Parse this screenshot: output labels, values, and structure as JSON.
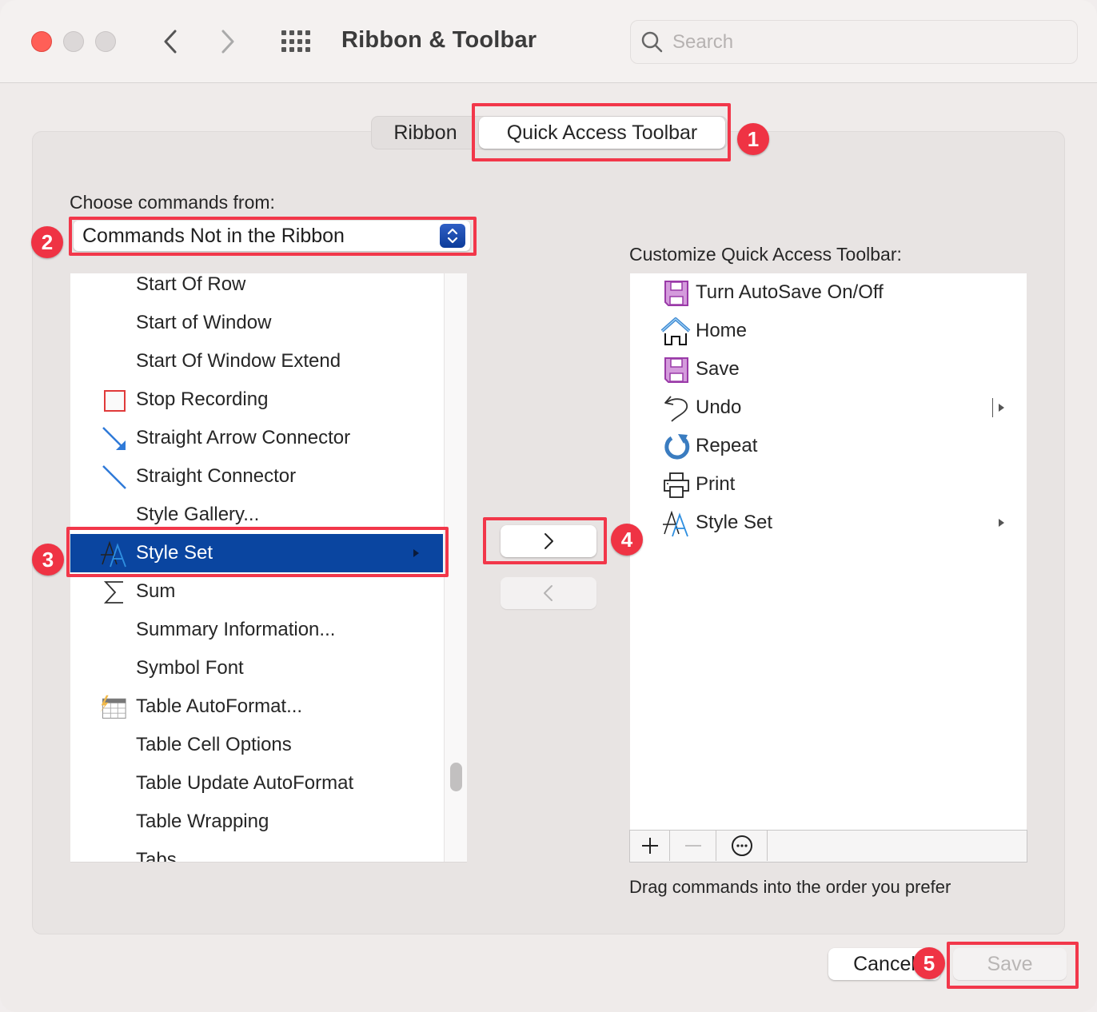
{
  "window": {
    "title": "Ribbon & Toolbar",
    "search_placeholder": "Search",
    "search_value": ""
  },
  "tabs": [
    {
      "label": "Ribbon",
      "selected": false
    },
    {
      "label": "Quick Access Toolbar",
      "selected": true
    }
  ],
  "left_pane": {
    "label": "Choose commands from:",
    "dropdown_value": "Commands Not in the Ribbon",
    "items": [
      {
        "label": "Start Of Row",
        "icon": "none"
      },
      {
        "label": "Start of Window",
        "icon": "none"
      },
      {
        "label": "Start Of Window Extend",
        "icon": "none"
      },
      {
        "label": "Stop Recording",
        "icon": "stop-square-icon"
      },
      {
        "label": "Straight Arrow Connector",
        "icon": "arrow-connector-icon"
      },
      {
        "label": "Straight Connector",
        "icon": "line-connector-icon"
      },
      {
        "label": "Style Gallery...",
        "icon": "none"
      },
      {
        "label": "Style Set",
        "icon": "style-set-icon",
        "selected": true,
        "has_submenu": true
      },
      {
        "label": "Sum",
        "icon": "sigma-icon"
      },
      {
        "label": "Summary Information...",
        "icon": "none"
      },
      {
        "label": "Symbol Font",
        "icon": "none"
      },
      {
        "label": "Table AutoFormat...",
        "icon": "table-autoformat-icon"
      },
      {
        "label": "Table Cell Options",
        "icon": "none"
      },
      {
        "label": "Table Update AutoFormat",
        "icon": "none"
      },
      {
        "label": "Table Wrapping",
        "icon": "none"
      },
      {
        "label": "Tabs",
        "icon": "none"
      }
    ]
  },
  "right_pane": {
    "label": "Customize Quick Access Toolbar:",
    "items": [
      {
        "label": "Turn AutoSave On/Off",
        "icon": "floppy-disk-icon"
      },
      {
        "label": "Home",
        "icon": "home-icon"
      },
      {
        "label": "Save",
        "icon": "floppy-disk-icon"
      },
      {
        "label": "Undo",
        "icon": "undo-icon",
        "has_split_submenu": true
      },
      {
        "label": "Repeat",
        "icon": "repeat-icon"
      },
      {
        "label": "Print",
        "icon": "printer-icon"
      },
      {
        "label": "Style Set",
        "icon": "style-set-icon",
        "has_submenu": true
      }
    ],
    "hint": "Drag commands into the order you prefer"
  },
  "buttons": {
    "add": ">",
    "remove": "<",
    "cancel": "Cancel",
    "save": "Save"
  },
  "annotations": [
    "1",
    "2",
    "3",
    "4",
    "5"
  ],
  "colors": {
    "selection": "#0a45a0",
    "annotation": "#ef3344",
    "close": "#ff5f57"
  }
}
